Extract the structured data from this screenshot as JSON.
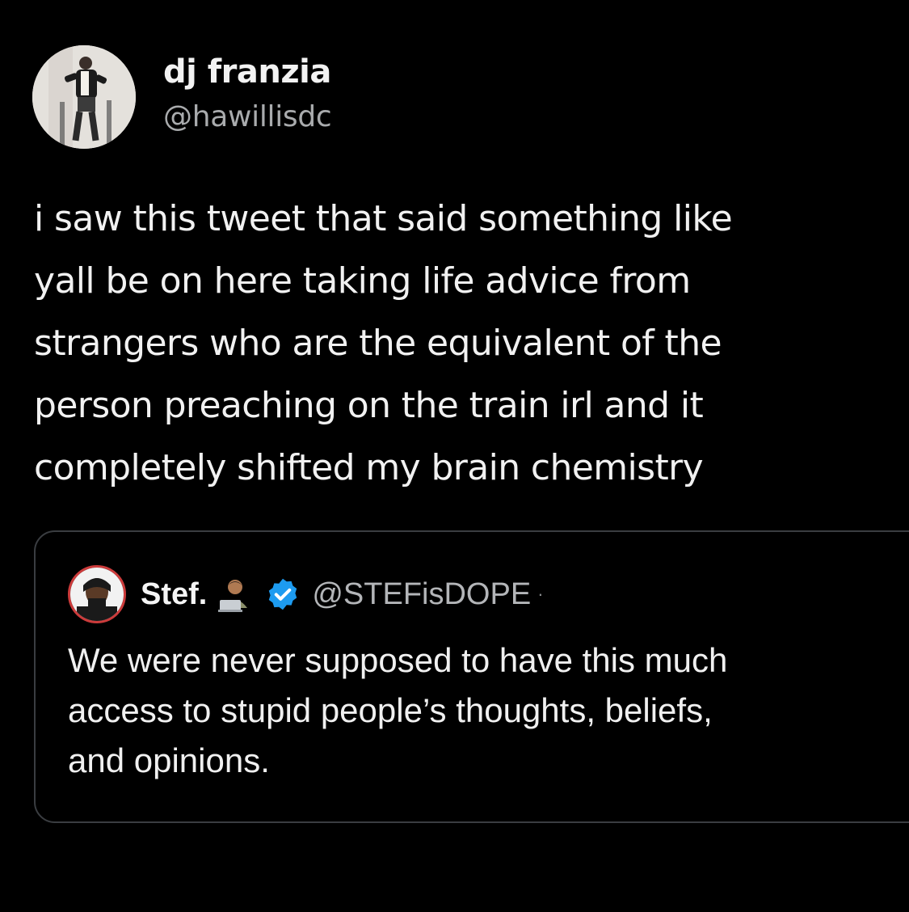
{
  "tweet": {
    "author": {
      "display_name": "dj franzia",
      "handle": "@hawillisdc",
      "avatar_icon": "profile-photo"
    },
    "text_lines": [
      "i saw this tweet that said something like",
      "yall be on here taking life advice from",
      "strangers who are the equivalent of the",
      "person preaching on the train irl and it",
      "completely shifted my brain chemistry"
    ]
  },
  "quoted_tweet": {
    "author": {
      "display_name": "Stef.",
      "emoji_icon": "man-technologist-emoji",
      "verified_icon": "verified-badge-icon",
      "handle": "@STEFisDOPE",
      "separator": "·"
    },
    "text_lines": [
      "We were never supposed to have this much",
      "access to stupid people’s thoughts, beliefs,",
      "and opinions."
    ]
  },
  "colors": {
    "background": "#000000",
    "text_primary": "#f1f1f1",
    "text_secondary": "#a9abad",
    "border": "#3a3d41",
    "verified_blue": "#1d9bf0"
  }
}
